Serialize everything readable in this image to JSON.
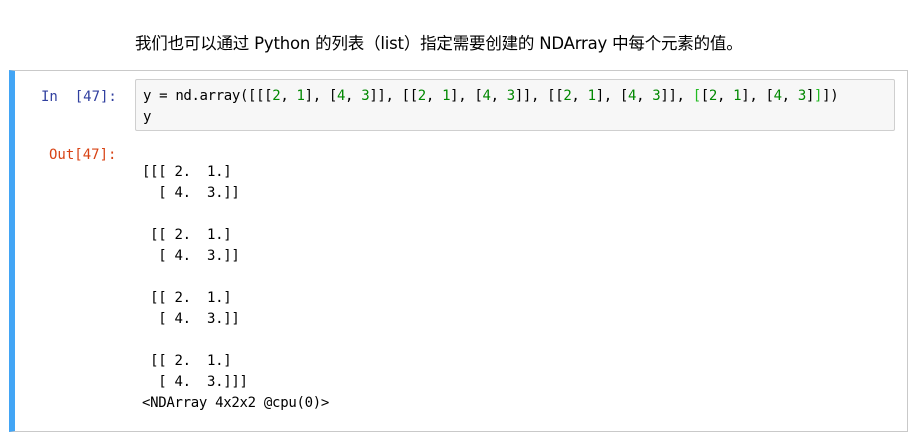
{
  "markdown": {
    "text": "我们也可以通过 Python 的列表（list）指定需要创建的 NDArray 中每个元素的值。"
  },
  "cell": {
    "in_prompt": "In  [47]:",
    "out_prompt": "Out[47]:",
    "code_line_2": "y",
    "output_lines": [
      "[[[ 2.  1.]",
      "  [ 4.  3.]]",
      "",
      " [[ 2.  1.]",
      "  [ 4.  3.]]",
      "",
      " [[ 2.  1.]",
      "  [ 4.  3.]]",
      "",
      " [[ 2.  1.]",
      "  [ 4.  3.]]]",
      "<NDArray 4x2x2 @cpu(0)>"
    ]
  },
  "code_tokens": {
    "t0": "y = nd.array([[[",
    "n1": "2",
    "t2": ", ",
    "n3": "1",
    "t4": "], [",
    "n5": "4",
    "t6": ", ",
    "n7": "3",
    "t8": "]], [[",
    "n9": "2",
    "t10": ", ",
    "n11": "1",
    "t12": "], [",
    "n13": "4",
    "t14": ", ",
    "n15": "3",
    "t16": "]], [[",
    "n17": "2",
    "t18": ", ",
    "n19": "1",
    "t20": "], [",
    "n21": "4",
    "t22": ", ",
    "n23": "3",
    "t24": "]], ",
    "h25": "[",
    "t26": "[",
    "n27": "2",
    "t28": ", ",
    "n29": "1",
    "t30": "], [",
    "n31": "4",
    "t32": ", ",
    "n33": "3",
    "t34": "]",
    "h35": "]",
    "t36": "])"
  },
  "colors": {
    "in_prompt": "#303f9f",
    "out_prompt": "#d84315",
    "cell_border_active": "#42a5f5",
    "number": "#008800",
    "bracket_match": "#22bb22"
  }
}
